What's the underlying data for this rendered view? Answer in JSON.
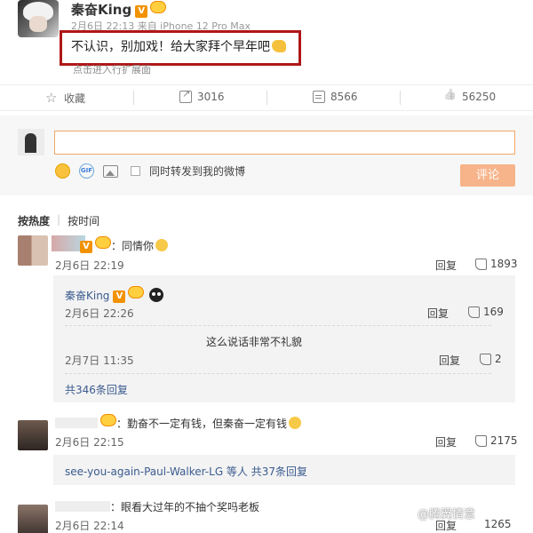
{
  "post": {
    "author": "秦奋King",
    "vip_badge": "V",
    "meta": "2月6日 22:13 来自 iPhone 12 Pro Max",
    "text": "不认识，别加戏！给大家拜个早年吧",
    "hint": "点击进入行扩展面"
  },
  "actions": [
    {
      "icon": "star-icon",
      "label": "收藏"
    },
    {
      "icon": "share-icon",
      "label": "3016"
    },
    {
      "icon": "comment-icon",
      "label": "8566"
    },
    {
      "icon": "like-icon",
      "label": "56250"
    }
  ],
  "composer": {
    "input_value": "",
    "repost_label": "同时转发到我的微博",
    "submit_label": "评论"
  },
  "sort": {
    "hot": "按热度",
    "sep": "|",
    "time": "按时间"
  },
  "comments": [
    {
      "author": "",
      "text": "：同情你",
      "time": "2月6日 22:19",
      "reply_label": "回复",
      "likes": "1893",
      "replies": [
        {
          "author": "秦奋King",
          "text": "",
          "time": "2月6日 22:26",
          "reply_label": "回复",
          "likes": "169"
        },
        {
          "author": "",
          "text": "这么说话非常不礼貌",
          "time": "2月7日 11:35",
          "reply_label": "回复",
          "likes": "2"
        }
      ],
      "more": "共346条回复"
    },
    {
      "author": "",
      "text": "：勤奋不一定有钱，但秦奋一定有钱",
      "time": "2月6日 22:15",
      "reply_label": "回复",
      "likes": "2175",
      "more_prefix": "see-you-again-Paul-Walker-LG 等人",
      "more": "共37条回复"
    },
    {
      "author": "",
      "text": "：眼看大过年的不抽个奖吗老板",
      "time": "2月6日 22:14",
      "reply_label": "回复",
      "likes": "1265"
    }
  ],
  "watermark": "@腾翼情意",
  "colors": {
    "highlight_box": "#b01717",
    "link": "#3b5b8f",
    "submit_bg": "#f7b48a",
    "input_border": "#f0a868"
  }
}
